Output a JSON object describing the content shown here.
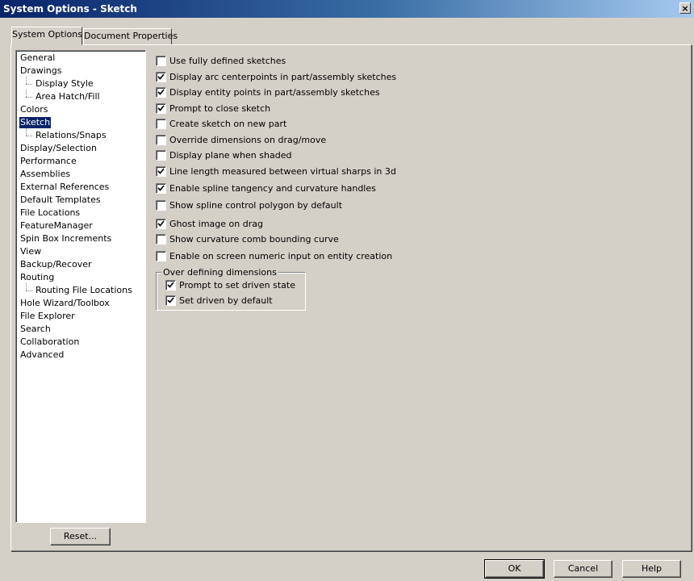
{
  "window": {
    "title": "System Options - Sketch",
    "close_label": "×"
  },
  "tabs": [
    {
      "label": "System Options",
      "active": true
    },
    {
      "label": "Document Properties",
      "active": false
    }
  ],
  "tree": [
    {
      "label": "General",
      "level": 0
    },
    {
      "label": "Drawings",
      "level": 0
    },
    {
      "label": "Display Style",
      "level": 1
    },
    {
      "label": "Area Hatch/Fill",
      "level": 1
    },
    {
      "label": "Colors",
      "level": 0
    },
    {
      "label": "Sketch",
      "level": 0,
      "selected": true
    },
    {
      "label": "Relations/Snaps",
      "level": 1
    },
    {
      "label": "Display/Selection",
      "level": 0
    },
    {
      "label": "Performance",
      "level": 0
    },
    {
      "label": "Assemblies",
      "level": 0
    },
    {
      "label": "External References",
      "level": 0
    },
    {
      "label": "Default Templates",
      "level": 0
    },
    {
      "label": "File Locations",
      "level": 0
    },
    {
      "label": "FeatureManager",
      "level": 0
    },
    {
      "label": "Spin Box Increments",
      "level": 0
    },
    {
      "label": "View",
      "level": 0
    },
    {
      "label": "Backup/Recover",
      "level": 0
    },
    {
      "label": "Routing",
      "level": 0
    },
    {
      "label": "Routing File Locations",
      "level": 1
    },
    {
      "label": "Hole Wizard/Toolbox",
      "level": 0
    },
    {
      "label": "File Explorer",
      "level": 0
    },
    {
      "label": "Search",
      "level": 0
    },
    {
      "label": "Collaboration",
      "level": 0
    },
    {
      "label": "Advanced",
      "level": 0
    }
  ],
  "options": [
    {
      "label": "Use fully defined sketches",
      "checked": false
    },
    {
      "label": "Display arc centerpoints in part/assembly sketches",
      "checked": true
    },
    {
      "label": "Display entity points in part/assembly sketches",
      "checked": true
    },
    {
      "label": "Prompt to close sketch",
      "checked": true
    },
    {
      "label": "Create sketch on new part",
      "checked": false
    },
    {
      "label": "Override dimensions on drag/move",
      "checked": false
    },
    {
      "label": "Display plane when shaded",
      "checked": false
    },
    {
      "label": "Line length measured between virtual sharps in 3d",
      "checked": true
    },
    {
      "label": "Enable spline tangency and curvature handles",
      "checked": true
    },
    {
      "label": "Show spline control polygon by default",
      "checked": false
    },
    {
      "label": "Ghost image on drag",
      "checked": true
    },
    {
      "label": "Show curvature comb bounding curve",
      "checked": false
    },
    {
      "label": "Enable on screen numeric input on entity creation",
      "checked": false
    }
  ],
  "group": {
    "title": "Over defining dimensions",
    "options": [
      {
        "label": "Prompt to set driven state",
        "checked": true
      },
      {
        "label": "Set driven by default",
        "checked": true
      }
    ]
  },
  "buttons": {
    "reset": "Reset...",
    "ok": "OK",
    "cancel": "Cancel",
    "help": "Help"
  }
}
